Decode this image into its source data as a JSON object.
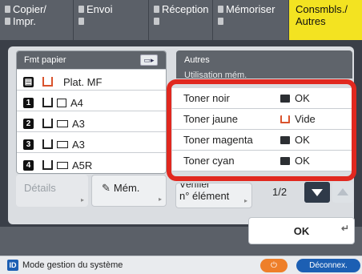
{
  "tabs": [
    {
      "line1": "Copier/",
      "line2": "Impr."
    },
    {
      "line1": "Envoi",
      "line2": ""
    },
    {
      "line1": "Réception",
      "line2": ""
    },
    {
      "line1": "Mémoriser",
      "line2": ""
    },
    {
      "line1": "Consmbls./",
      "line2": "Autres"
    }
  ],
  "paper_panel": {
    "header": "Fmt papier",
    "rows": [
      {
        "tray": "",
        "size": "Plat. MF"
      },
      {
        "tray": "1",
        "size": "A4"
      },
      {
        "tray": "2",
        "size": "A3"
      },
      {
        "tray": "3",
        "size": "A3"
      },
      {
        "tray": "4",
        "size": "A5R"
      }
    ],
    "details_label": "Détails",
    "mem_label": "Mém."
  },
  "others_panel": {
    "header": "Autres",
    "partial_line": "Utilisation mém.",
    "toner": [
      {
        "name": "Toner noir",
        "status": "OK"
      },
      {
        "name": "Toner jaune",
        "status": "Vide"
      },
      {
        "name": "Toner magenta",
        "status": "OK"
      },
      {
        "name": "Toner cyan",
        "status": "OK"
      }
    ],
    "verify_label_hidden": "Vérifier",
    "verify_label": "n° élément",
    "page_indicator": "1/2"
  },
  "ok_label": "OK",
  "status_bar": {
    "mode": "Mode gestion du système",
    "disconnect": "Déconnex."
  },
  "colors": {
    "accent": "#f3e321",
    "highlight": "#e1281f",
    "empty": "#d9532d"
  }
}
